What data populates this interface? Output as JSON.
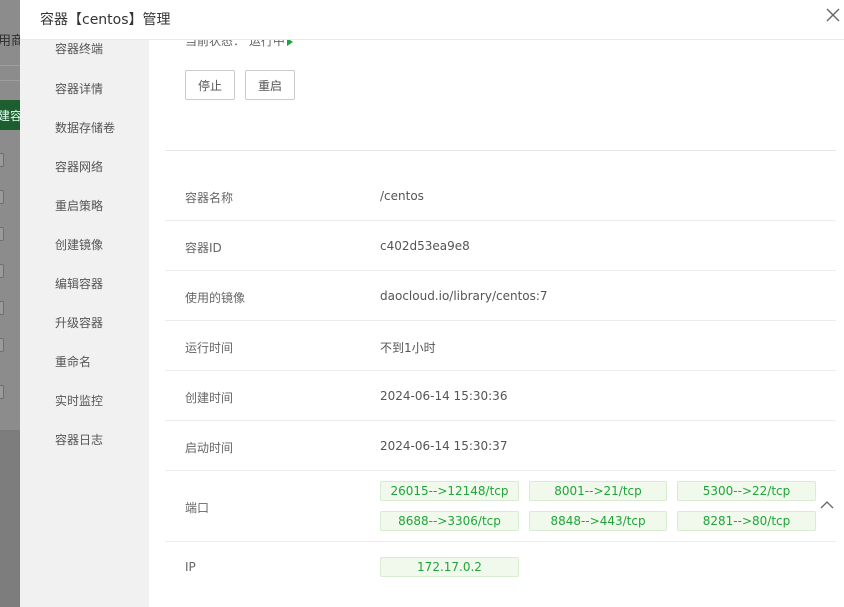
{
  "background": {
    "partial_text": "用商",
    "green_button_partial": "建容"
  },
  "modal": {
    "title": "容器【centos】管理"
  },
  "sidebar": {
    "items": [
      {
        "label": "容器终端"
      },
      {
        "label": "容器详情"
      },
      {
        "label": "数据存储卷"
      },
      {
        "label": "容器网络"
      },
      {
        "label": "重启策略"
      },
      {
        "label": "创建镜像"
      },
      {
        "label": "编辑容器"
      },
      {
        "label": "升级容器"
      },
      {
        "label": "重命名"
      },
      {
        "label": "实时监控"
      },
      {
        "label": "容器日志"
      }
    ]
  },
  "status": {
    "label": "当前状态：",
    "value": "运行中"
  },
  "actions": {
    "stop_label": "停止",
    "restart_label": "重启"
  },
  "details": {
    "name": {
      "label": "容器名称",
      "value": "/centos"
    },
    "id": {
      "label": "容器ID",
      "value": "c402d53ea9e8"
    },
    "image": {
      "label": "使用的镜像",
      "value": "daocloud.io/library/centos:7"
    },
    "uptime": {
      "label": "运行时间",
      "value": "不到1小时"
    },
    "created": {
      "label": "创建时间",
      "value": "2024-06-14 15:30:36"
    },
    "started": {
      "label": "启动时间",
      "value": "2024-06-14 15:30:37"
    },
    "ports": {
      "label": "端口",
      "items": [
        "26015-->12148/tcp",
        "8001-->21/tcp",
        "5300-->22/tcp",
        "8688-->3306/tcp",
        "8848-->443/tcp",
        "8281-->80/tcp"
      ]
    },
    "ip": {
      "label": "IP",
      "value": "172.17.0.2"
    }
  },
  "colors": {
    "accent_green": "#20a53a",
    "tag_bg": "#f0f9eb",
    "sidebar_bg": "#f1f1f1"
  }
}
